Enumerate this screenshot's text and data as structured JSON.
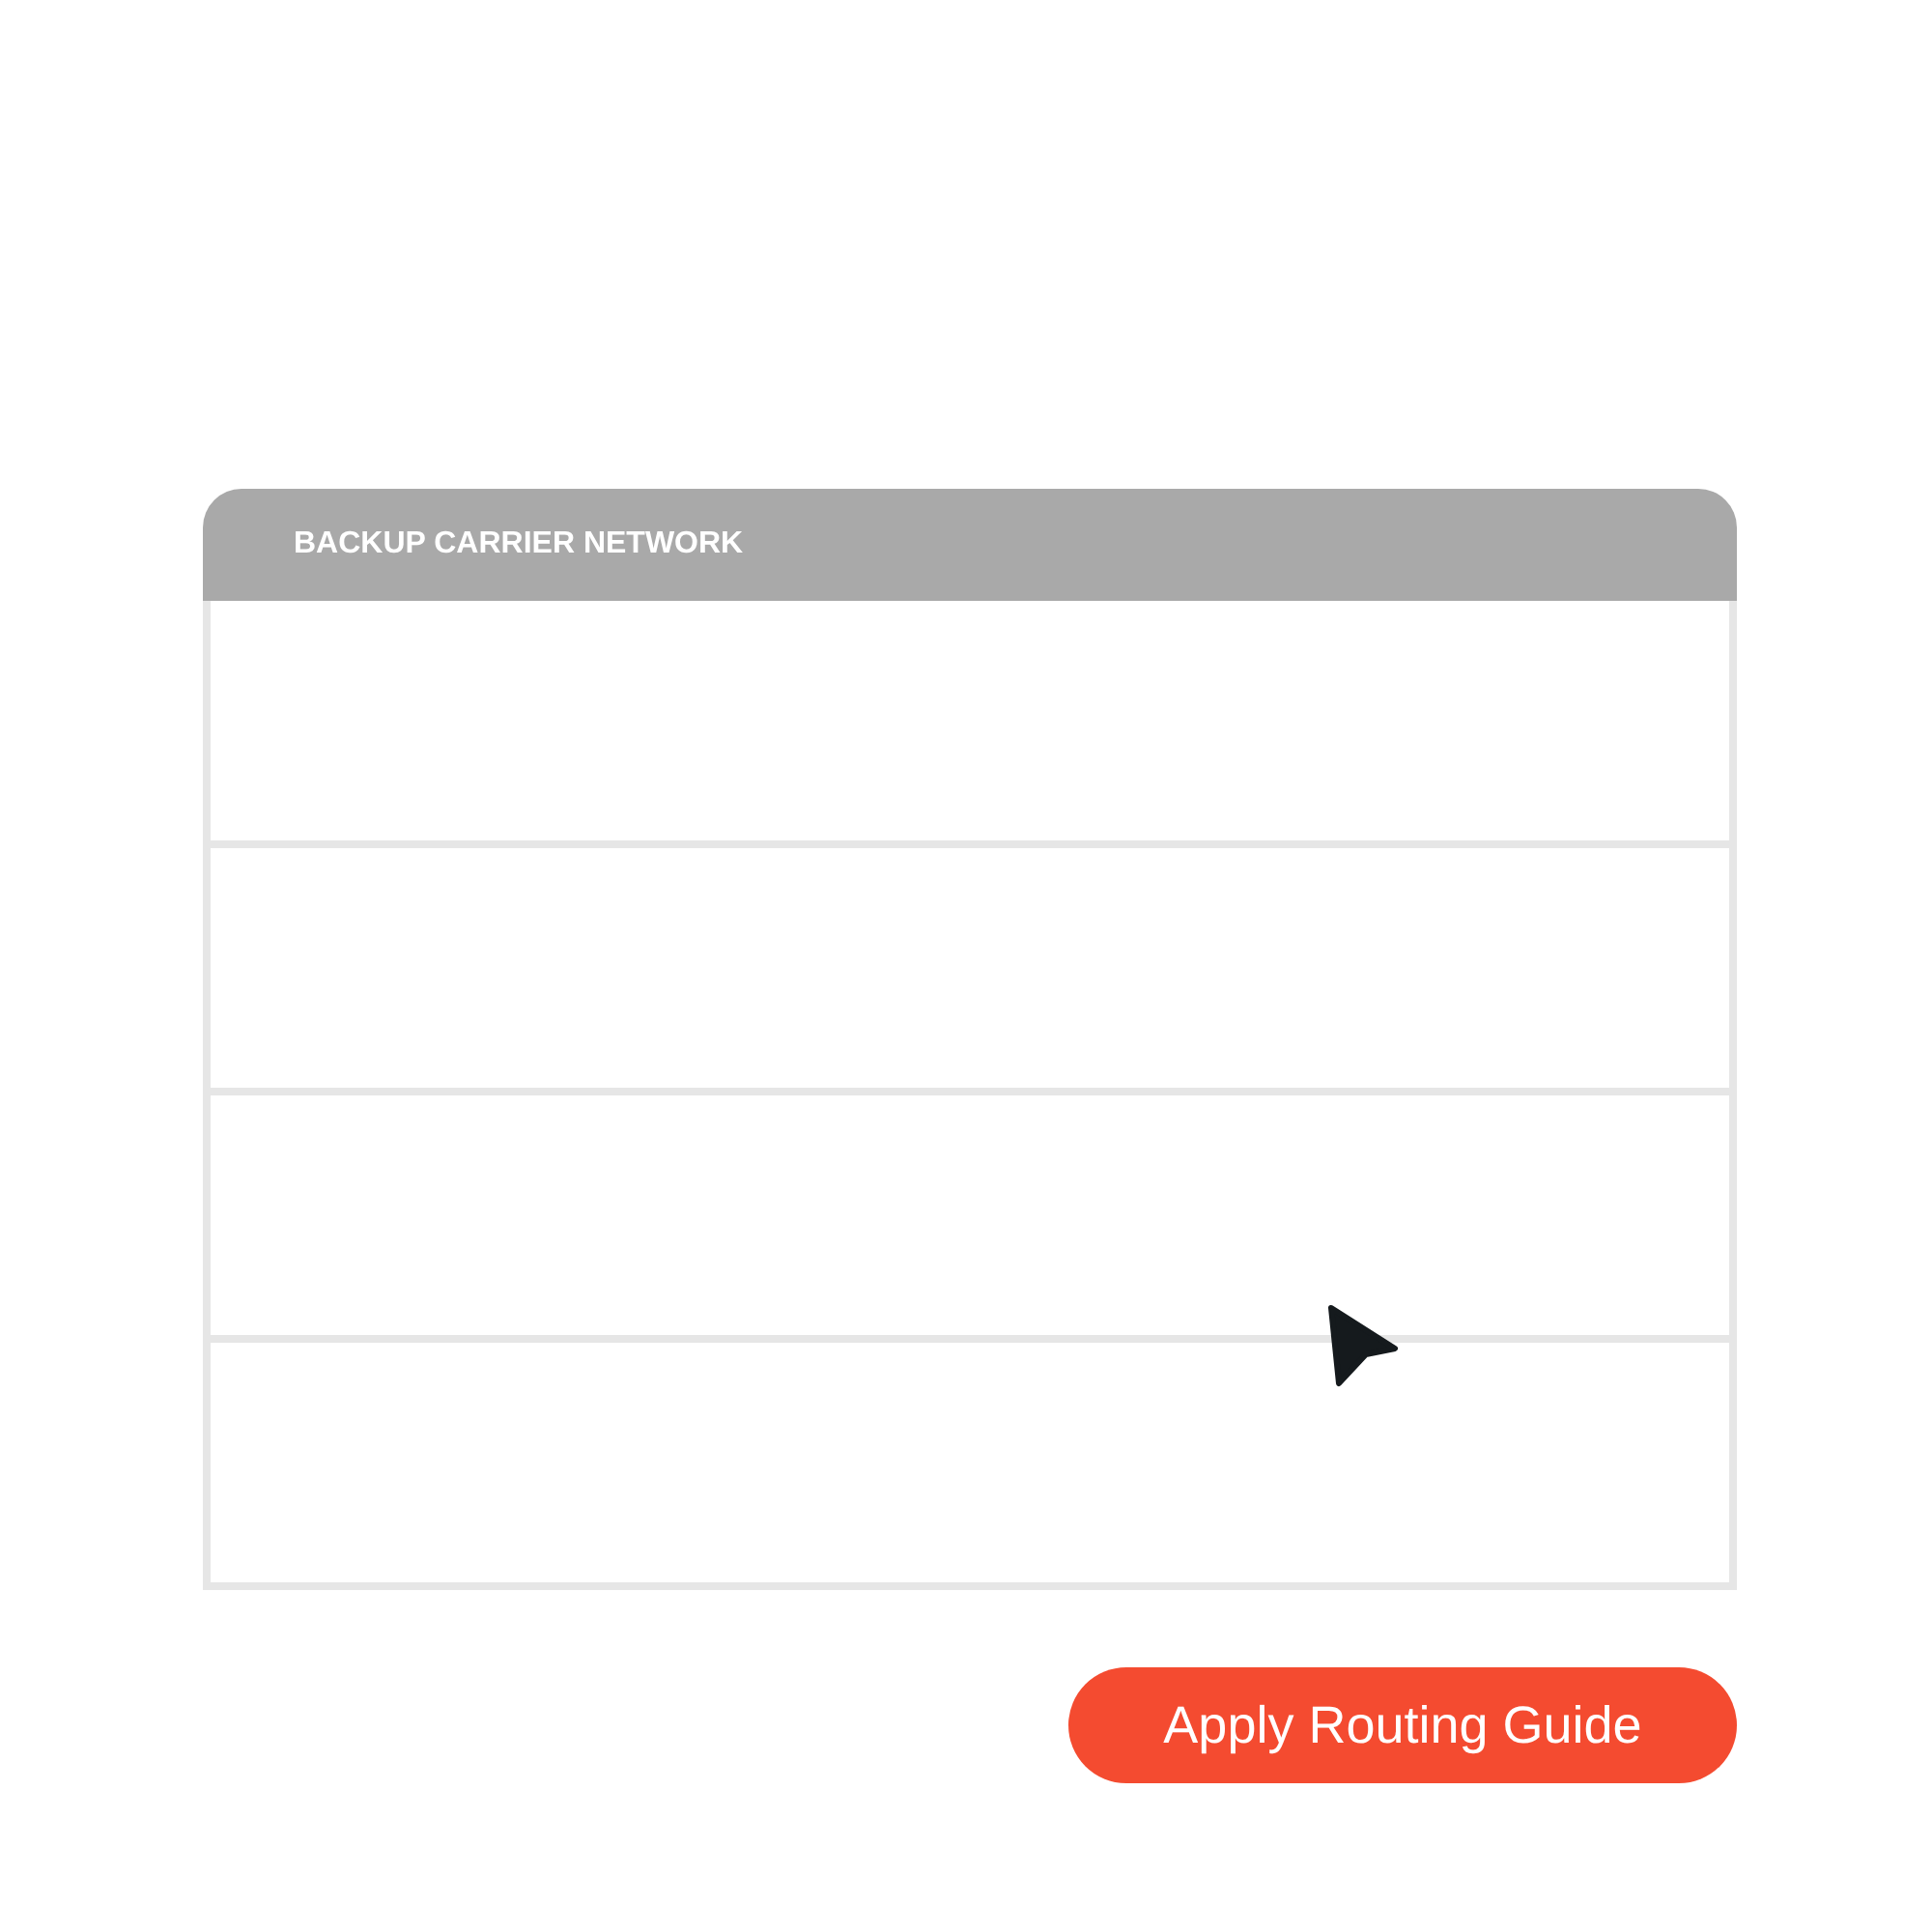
{
  "panel": {
    "title": "BACKUP CARRIER NETWORK",
    "rows": [
      {
        "kind": "empty"
      },
      {
        "kind": "empty"
      },
      {
        "kind": "empty"
      },
      {
        "kind": "empty"
      }
    ]
  },
  "button": {
    "label": "Apply Routing Guide"
  }
}
